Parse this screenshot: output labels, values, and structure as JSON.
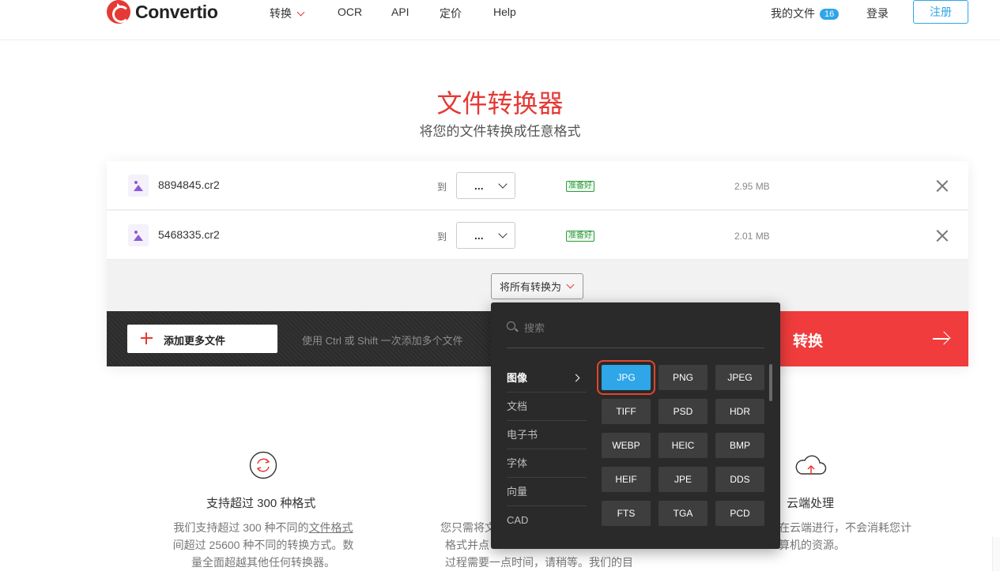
{
  "header": {
    "brand": "Convertio",
    "nav": [
      {
        "label": "转换",
        "has_dropdown": true
      },
      {
        "label": "OCR"
      },
      {
        "label": "API"
      },
      {
        "label": "定价"
      },
      {
        "label": "Help"
      }
    ],
    "my_files_label": "我的文件",
    "my_files_count": "16",
    "login_label": "登录",
    "register_label": "注册"
  },
  "hero": {
    "title": "文件转换器",
    "subtitle": "将您的文件转换成任意格式"
  },
  "files": [
    {
      "name": "8894845.cr2",
      "to_label": "到",
      "format": "...",
      "status": "准备好",
      "size": "2.95 MB"
    },
    {
      "name": "5468335.cr2",
      "to_label": "到",
      "format": "...",
      "status": "准备好",
      "size": "2.01 MB"
    }
  ],
  "convert_all_label": "将所有转换为",
  "bottom_bar": {
    "add_files_label": "添加更多文件",
    "hint": "使用 Ctrl 或 Shift 一次添加多个文件",
    "convert_label": "转换"
  },
  "dropdown": {
    "search_placeholder": "搜索",
    "categories": [
      "图像",
      "文档",
      "电子书",
      "字体",
      "向量",
      "CAD"
    ],
    "active_category": "图像",
    "formats": [
      "JPG",
      "PNG",
      "JPEG",
      "TIFF",
      "PSD",
      "HDR",
      "WEBP",
      "HEIC",
      "BMP",
      "HEIF",
      "JPE",
      "DDS",
      "FTS",
      "TGA",
      "PCD"
    ],
    "selected_format": "JPG"
  },
  "features": [
    {
      "icon": "refresh-icon",
      "title": "支持超过 300 种格式",
      "lines": [
        "我们支持超过 300 种不同的文件格式",
        "间超过 25600 种不同的转换方式。数",
        "量全面超越其他任何转换器。"
      ],
      "link_text": "文件格式"
    },
    {
      "icon": "none",
      "title": "",
      "lines": [
        "您只需将文",
        "格式并点",
        "过程需要一点时间，请稍等。我们的目"
      ]
    },
    {
      "icon": "cloud-upload-icon",
      "title": "云端处理",
      "lines": [
        "在云端进行，不会消耗您计",
        "算机的资源。"
      ]
    }
  ],
  "colors": {
    "brand_red": "#e53935",
    "accent_blue": "#2ea6e8",
    "convert_red": "#f03c3c",
    "popup_bg": "#2a2a2a",
    "ready_green": "#2e9d3f"
  }
}
